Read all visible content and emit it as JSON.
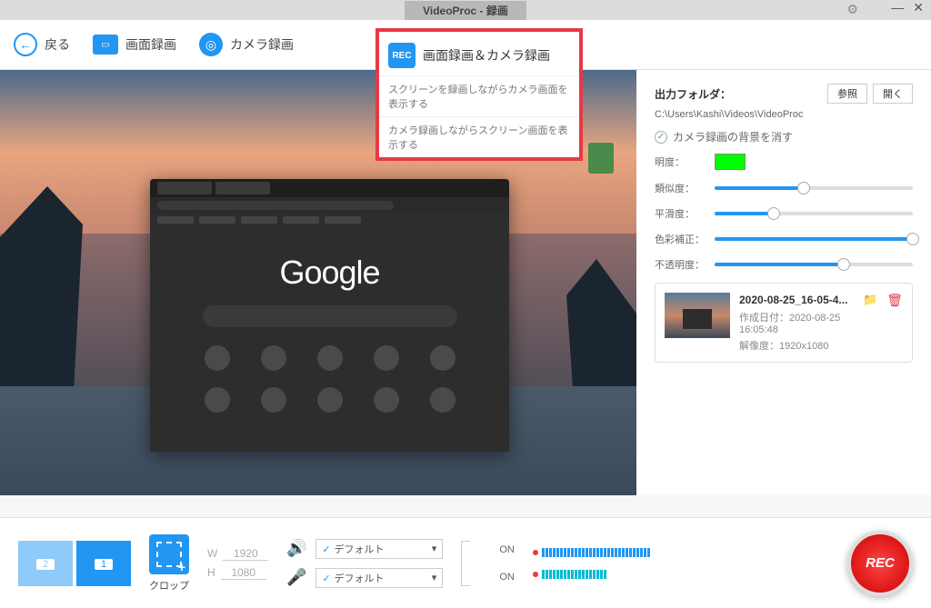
{
  "titlebar": {
    "title": "VideoProc - 録画"
  },
  "toolbar": {
    "back": "戻る",
    "screen_rec": "画面録画",
    "camera_rec": "カメラ録画"
  },
  "dropdown": {
    "title": "画面録画＆カメラ録画",
    "opt1": "スクリーンを録画しながらカメラ画面を表示する",
    "opt2": "カメラ録画しながらスクリーン画面を表示する"
  },
  "side": {
    "output_label": "出力フォルダ：",
    "browse": "参照",
    "open": "開く",
    "path": "C:\\Users\\Kashi\\Videos\\VideoProc",
    "chk_label": "カメラ録画の背景を消す",
    "brightness": "明度：",
    "similarity": "類似度：",
    "smoothness": "平滑度：",
    "color_corr": "色彩補正：",
    "opacity": "不透明度："
  },
  "file": {
    "name": "2020-08-25_16-05-4...",
    "created_label": "作成日付：",
    "created_val": "2020-08-25 16:05:48",
    "res_label": "解像度：",
    "res_val": "1920x1080"
  },
  "bottom": {
    "screen1": "1",
    "screen2": "2",
    "crop": "クロップ",
    "w": "W",
    "wval": "1920",
    "h": "H",
    "hval": "1080",
    "default": "デフォルト",
    "on": "ON",
    "rec": "REC"
  },
  "browser": {
    "logo": "Google"
  }
}
